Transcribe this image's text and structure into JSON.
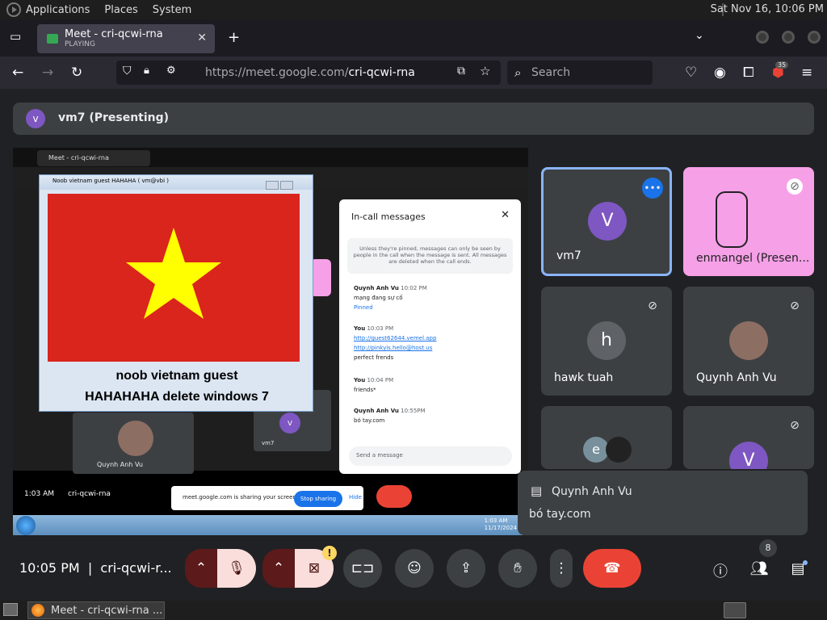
{
  "desktop": {
    "menus": [
      "Applications",
      "Places",
      "System"
    ],
    "clock": "Sat Nov 16, 10:06 PM"
  },
  "browser": {
    "tab": {
      "title": "Meet - cri-qcwi-rna",
      "status": "PLAYING",
      "close": "✕"
    },
    "new_tab": "+",
    "url_host": "https://meet.google.com/",
    "url_path": "cri-qcwi-rna",
    "search_placeholder": "Search",
    "badge": "35"
  },
  "meet": {
    "presenter_initial": "v",
    "presenting_label": "vm7 (Presenting)",
    "shared_screen": {
      "inner_tab_title": "Meet - cri-qcwi-rna",
      "xp_window_title": "Noob vietnam guest HAHAHA ( vm@vbi )",
      "caption_line1": "noob vietnam guest",
      "caption_line2": "HAHAHAHA delete windows 7",
      "panel_title": "In-call messages",
      "panel_note": "Unless they're pinned, messages can only be seen by people in the call when the message is sent. All messages are deleted when the call ends.",
      "messages": [
        {
          "who": "Quynh Anh Vu",
          "time": "10:02 PM",
          "text": "mạng đang sự cố",
          "pinned": "Pinned"
        },
        {
          "who": "You",
          "time": "10:03 PM",
          "link1": "http://guest62644.vemel.app",
          "link2": "http://pinkyis.hello@host.us",
          "text": "perfect frends"
        },
        {
          "who": "You",
          "time": "10:04 PM",
          "text": "friends*"
        },
        {
          "who": "Quynh Anh Vu",
          "time": "10:55PM",
          "text": "bó tay.com"
        }
      ],
      "send_placeholder": "Send a message",
      "inner_time": "1:03 AM",
      "inner_code": "cri-qcwi-rna",
      "inner_tile_name": "Quynh Anh Vu",
      "inner_tile_name2": "vm7",
      "sharing_text": "meet.google.com is sharing your screen.",
      "stop_sharing": "Stop sharing",
      "hide": "Hide",
      "taskbar_clock_line1": "1:03 AM",
      "taskbar_clock_line2": "11/17/2024"
    },
    "participants": [
      {
        "initial": "V",
        "name": "vm7",
        "color": "#7e57c2"
      },
      {
        "initial": "",
        "name": "enmangel (Presen...",
        "color": "#f6a0e8"
      },
      {
        "initial": "h",
        "name": "hawk tuah",
        "color": "#5f6368"
      },
      {
        "initial": "",
        "name": "Quynh Anh Vu",
        "color": "#8d6e63"
      },
      {
        "initial": "e",
        "name": "",
        "color": "#78909c"
      },
      {
        "initial": "V",
        "name": "",
        "color": "#7e57c2"
      }
    ],
    "notification": {
      "from": "Quynh Anh Vu",
      "text": "bó tay.com"
    },
    "controls": {
      "time": "10:05 PM",
      "meeting_code": "cri-qcwi-r...",
      "people_count": "8"
    }
  },
  "taskbar": {
    "task": "Meet - cri-qcwi-rna ..."
  }
}
